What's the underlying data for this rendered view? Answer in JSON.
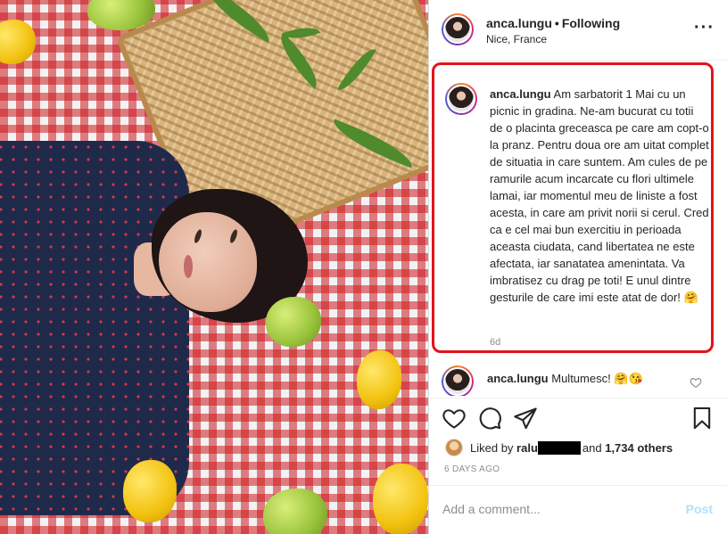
{
  "header": {
    "username": "anca.lungu",
    "separator": "•",
    "follow_status": "Following",
    "location": "Nice, France",
    "more_icon": "more-options-icon"
  },
  "caption": {
    "username": "anca.lungu",
    "text": "Am sarbatorit 1 Mai cu un picnic in gradina. Ne-am bucurat cu totii de o placinta greceasca pe care am copt-o la pranz. Pentru doua ore am uitat complet de situatia in care suntem. Am cules de pe ramurile acum incarcate cu flori ultimele lamai, iar momentul meu de liniste a fost acesta, in care am privit norii si cerul. Cred ca e cel mai bun exercitiu in perioada aceasta ciudata, cand libertatea ne este afectata, iar sanatatea amenintata. Va imbratisez cu drag pe toti! E unul dintre gesturile de care imi este atat de dor! 🤗",
    "time": "6d"
  },
  "comment": {
    "username": "anca.lungu",
    "text": "Multumesc! 🤗😘"
  },
  "likes": {
    "prefix": "Liked by",
    "user": "ralu",
    "and": "and",
    "others": "1,734 others"
  },
  "post_date": "6 DAYS AGO",
  "add_comment": {
    "placeholder": "Add a comment...",
    "post_label": "Post"
  },
  "colors": {
    "highlight_border": "#e3131b",
    "post_button": "#b2dffc",
    "secondary_text": "#8e8e8e"
  }
}
